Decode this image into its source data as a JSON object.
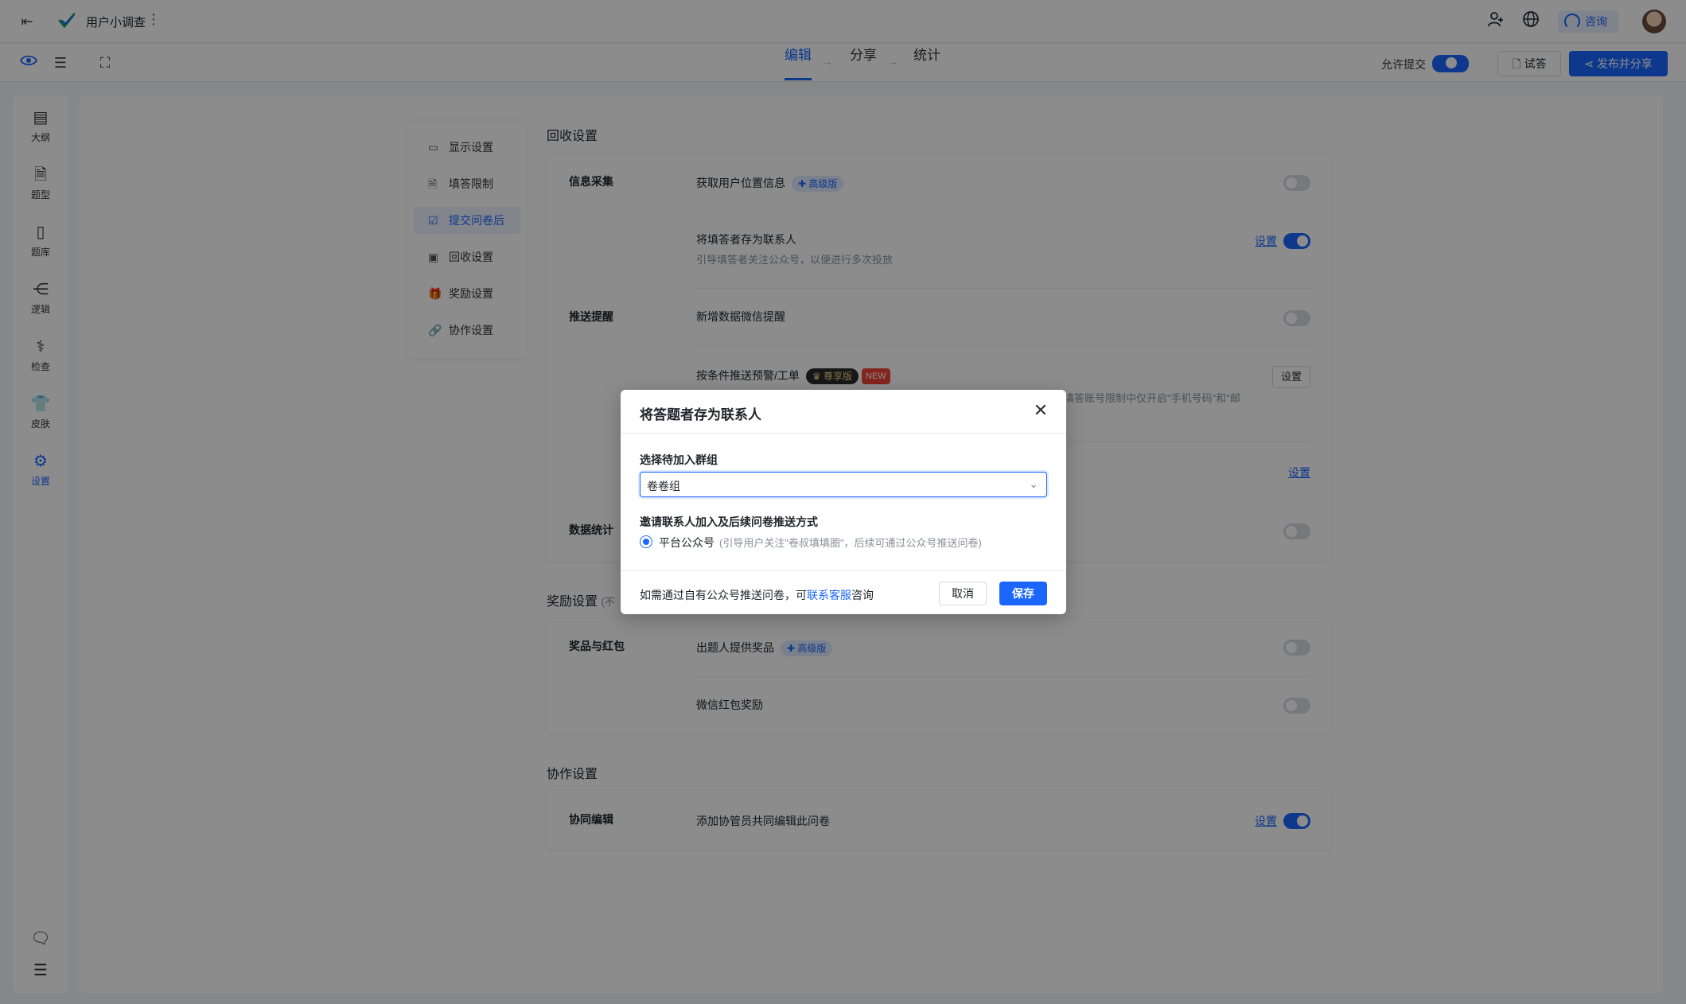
{
  "topbar": {
    "title": "用户小调查",
    "consult_label": "咨询"
  },
  "subbar": {
    "steps": [
      "编辑",
      "分享",
      "统计"
    ],
    "allow_submit_label": "允许提交",
    "try_label": "试答",
    "publish_label": "发布并分享"
  },
  "rail": {
    "items": [
      {
        "label": "大纲",
        "icon": "outline-icon"
      },
      {
        "label": "题型",
        "icon": "question-type-icon"
      },
      {
        "label": "题库",
        "icon": "question-bank-icon"
      },
      {
        "label": "逻辑",
        "icon": "logic-icon"
      },
      {
        "label": "检查",
        "icon": "check-icon"
      },
      {
        "label": "皮肤",
        "icon": "skin-icon"
      },
      {
        "label": "设置",
        "icon": "settings-icon"
      }
    ]
  },
  "side_nav": {
    "items": [
      "显示设置",
      "填答限制",
      "提交问卷后",
      "回收设置",
      "奖励设置",
      "协作设置"
    ],
    "active_index": 2
  },
  "sections": {
    "recycle_title": "回收设置",
    "reward_title": "奖励设置",
    "reward_title_suffix": "(不",
    "collab_title": "协作设置"
  },
  "recycle_card": {
    "info_group": "信息采集",
    "get_location": "获取用户位置信息",
    "pro_badge": "高级版",
    "save_contact": "将填答者存为联系人",
    "save_contact_sub": "引导填答者关注公众号，以便进行多次投放",
    "settings_link": "设置",
    "push_group": "推送提醒",
    "wechat_remind": "新增数据微信提醒",
    "conditional_push": "按条件推送预警/工单",
    "vip_badge": "尊享版",
    "new_badge": "NEW",
    "conditional_desc_tail": "填答账号限制中仅开启\"手机号码\"和\"邮",
    "settings_button": "设置",
    "data_group": "数据统计"
  },
  "reward_card": {
    "group": "奖品与红包",
    "prize": "出题人提供奖品",
    "pro_badge": "高级版",
    "red_packet": "微信红包奖励"
  },
  "collab_card": {
    "group": "协同编辑",
    "add_collab": "添加协管员共同编辑此问卷",
    "settings_link": "设置"
  },
  "modal": {
    "title": "将答题者存为联系人",
    "group_label": "选择待加入群组",
    "group_value": "卷卷组",
    "invite_label": "邀请联系人加入及后续问卷推送方式",
    "radio_label": "平台公众号",
    "radio_hint": "(引导用户关注\"卷叔填填圈\"，后续可通过公众号推送问卷)",
    "footer_prefix": "如需通过自有公众号推送问卷，可",
    "footer_link": "联系客服",
    "footer_suffix": "咨询",
    "cancel": "取消",
    "save": "保存"
  },
  "colors": {
    "accent": "#1a66ff",
    "new_badge": "#f04438"
  }
}
